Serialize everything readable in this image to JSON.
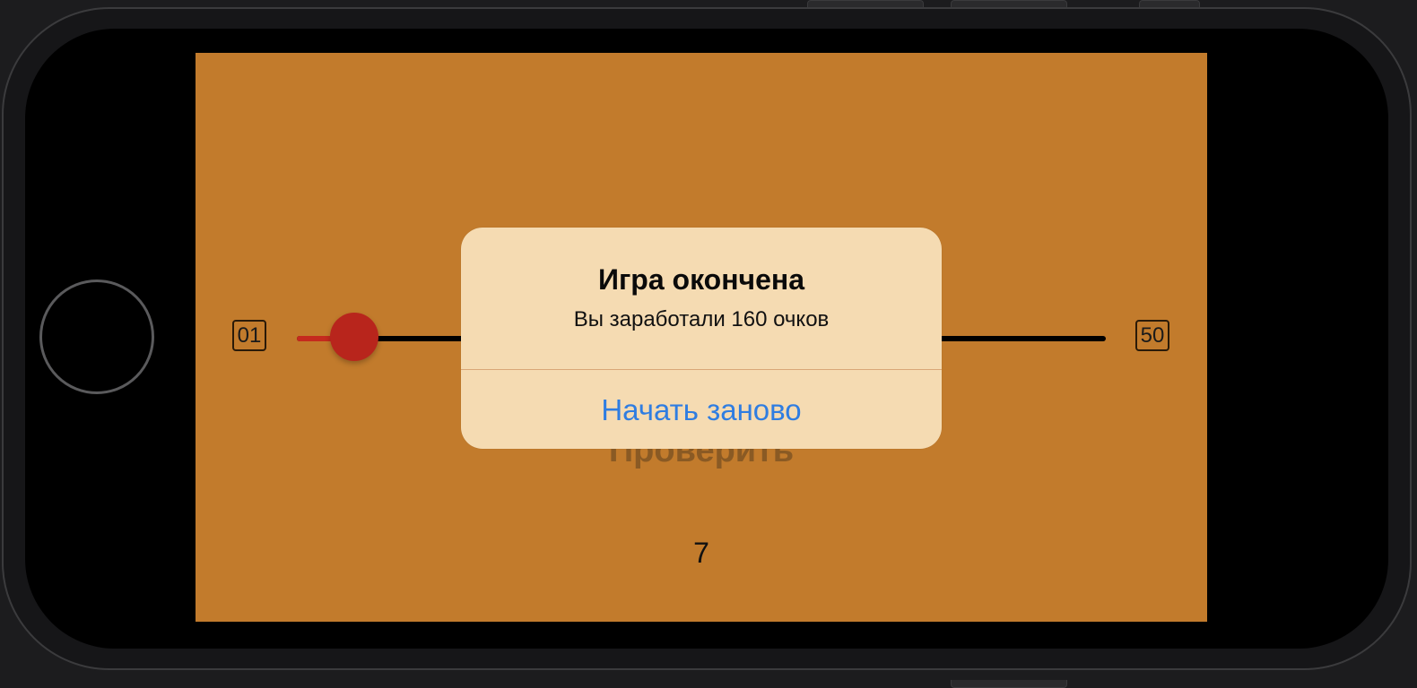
{
  "device": {
    "hardware_buttons": [
      "home"
    ]
  },
  "game": {
    "slider": {
      "min_label": "01",
      "max_label": "50",
      "min_value": 1,
      "max_value": 50,
      "current_value": 1
    },
    "check_button_label": "Проверить",
    "target_number": "7",
    "background_color": "#C27B2C",
    "slider_fill_color": "#C52A1E",
    "thumb_color": "#B8251C"
  },
  "alert": {
    "title": "Игра окончена",
    "message": "Вы заработали 160 очков",
    "action_label": "Начать заново",
    "action_color": "#2F7DE1",
    "background_color": "#F5DBB2"
  }
}
